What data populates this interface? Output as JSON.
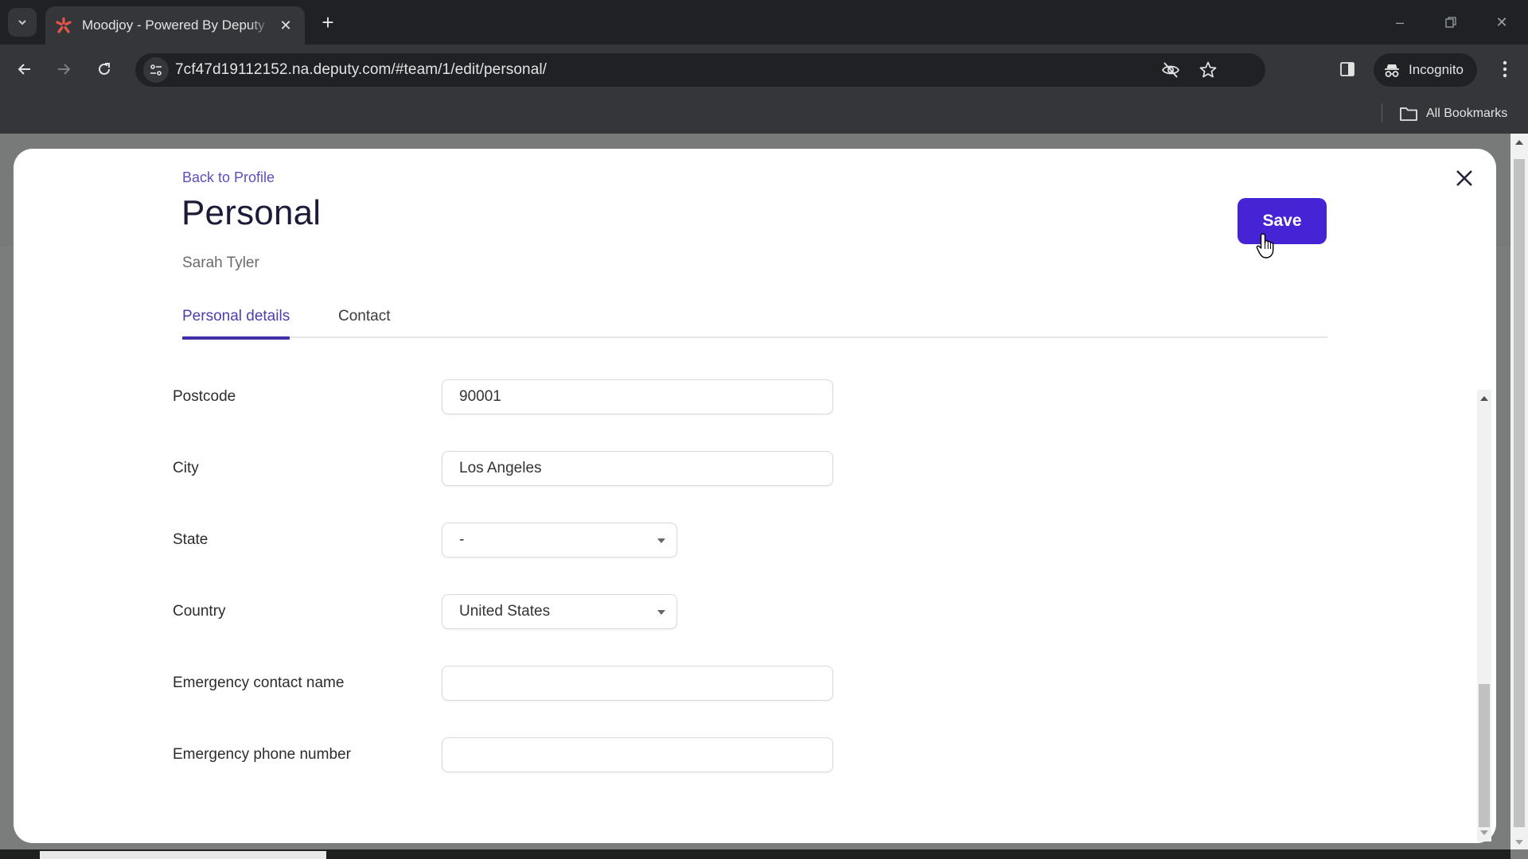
{
  "browser": {
    "tab": {
      "title": "Moodjoy - Powered By Deputy",
      "favicon": "deputy-logo-icon"
    },
    "new_tab_label": "+",
    "url": "7cf47d19112152.na.deputy.com/#team/1/edit/personal/",
    "incognito_label": "Incognito",
    "bookmarks_label": "All Bookmarks",
    "icons": {
      "tab_search": "chevron-down-icon",
      "back": "arrow-left-icon",
      "forward": "arrow-right-icon",
      "reload": "reload-icon",
      "site_info": "tune-icon",
      "tracking": "eye-off-icon",
      "bookmark": "star-icon",
      "side_panel": "side-panel-icon",
      "menu": "kebab-menu-icon"
    }
  },
  "modal": {
    "back_link": "Back to Profile",
    "title": "Personal",
    "subtitle": "Sarah Tyler",
    "save_label": "Save",
    "tabs": [
      {
        "label": "Personal details",
        "active": true
      },
      {
        "label": "Contact",
        "active": false
      }
    ],
    "fields": [
      {
        "label": "Postcode",
        "type": "text",
        "value": "90001"
      },
      {
        "label": "City",
        "type": "text",
        "value": "Los Angeles"
      },
      {
        "label": "State",
        "type": "select",
        "value": "-"
      },
      {
        "label": "Country",
        "type": "select",
        "value": "United States"
      },
      {
        "label": "Emergency contact name",
        "type": "text",
        "value": ""
      },
      {
        "label": "Emergency phone number",
        "type": "text",
        "value": ""
      }
    ]
  },
  "colors": {
    "accent": "#4624d6",
    "link": "#5b4fbf",
    "tab_active": "#3e2fa8",
    "title": "#1d1b3a",
    "overlay": "#7b7d7c"
  }
}
